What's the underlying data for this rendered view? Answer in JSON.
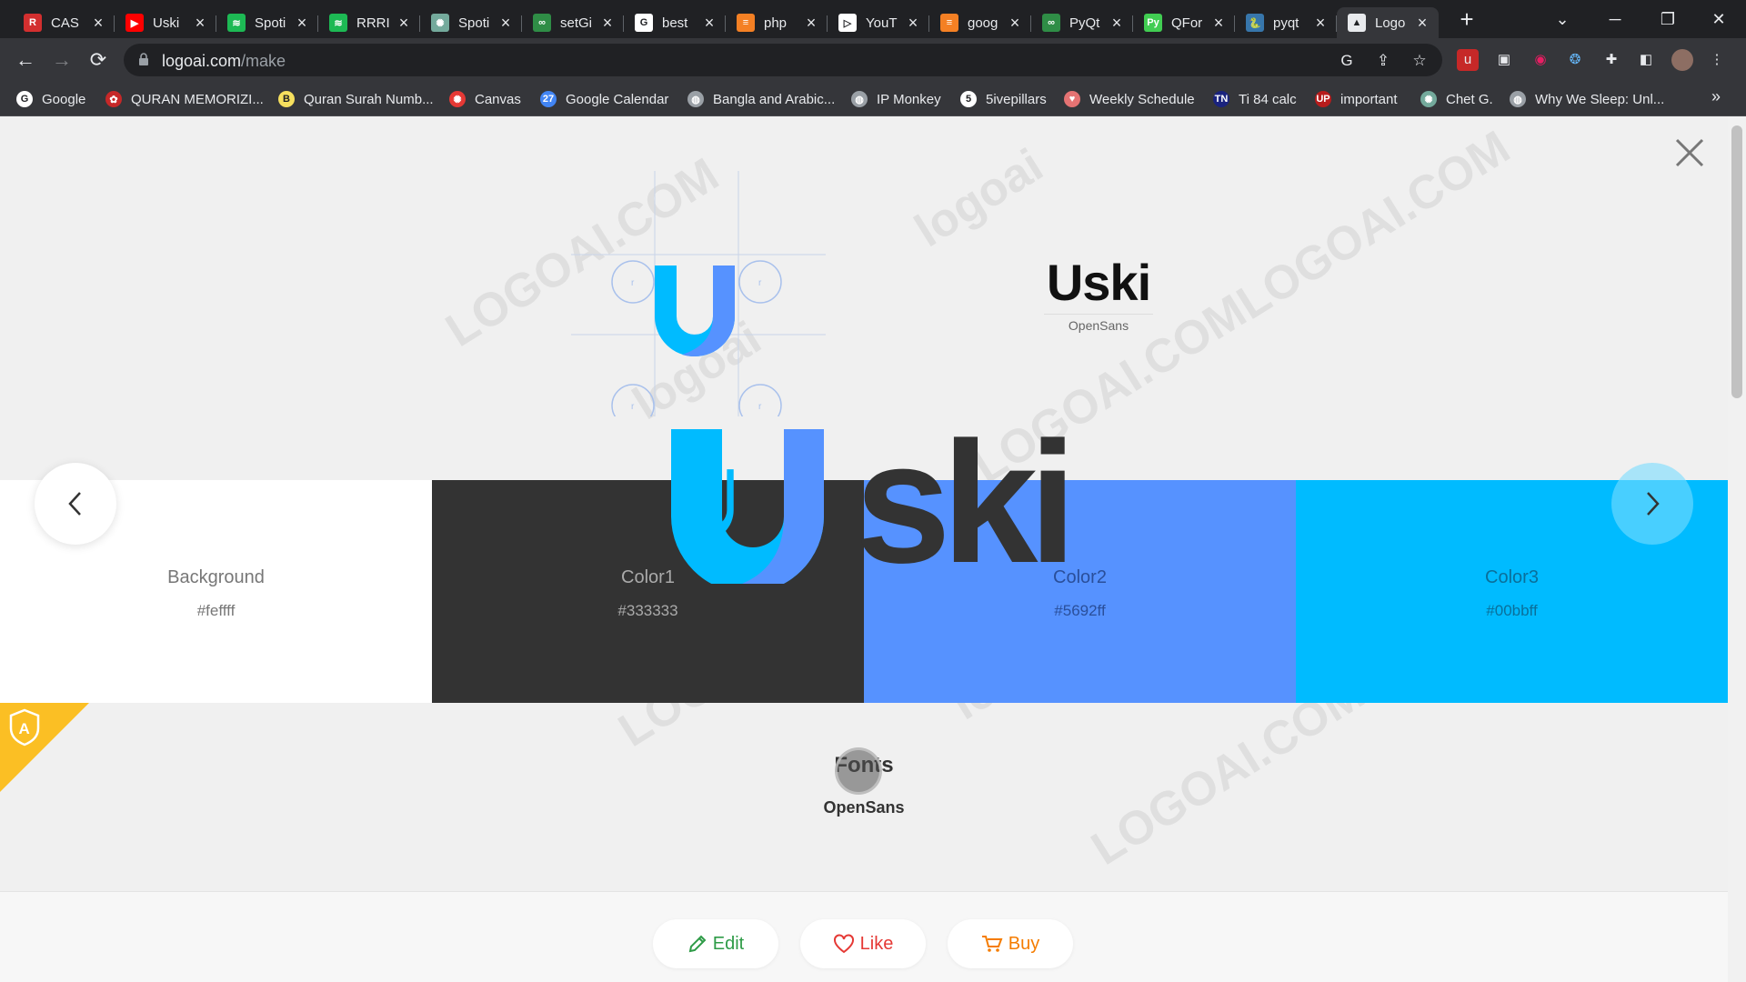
{
  "browser": {
    "tabs": [
      {
        "title": "CAS",
        "icon": "r-logo-icon",
        "color": "#d32f2f",
        "glyph": "R"
      },
      {
        "title": "Uski",
        "icon": "youtube-icon",
        "color": "#ff0000",
        "glyph": "▶"
      },
      {
        "title": "Spoti",
        "icon": "spotify-icon",
        "color": "#1db954",
        "glyph": "≋"
      },
      {
        "title": "RRRI",
        "icon": "spotify-icon",
        "color": "#1db954",
        "glyph": "≋"
      },
      {
        "title": "Spoti",
        "icon": "chatgpt-icon",
        "color": "#74aa9c",
        "glyph": "✺"
      },
      {
        "title": "setGi",
        "icon": "gfg-icon",
        "color": "#2f8d46",
        "glyph": "∞"
      },
      {
        "title": "best",
        "icon": "google-icon",
        "color": "#ffffff",
        "glyph": "G"
      },
      {
        "title": "php",
        "icon": "stackoverflow-icon",
        "color": "#f48024",
        "glyph": "≡"
      },
      {
        "title": "YouT",
        "icon": "youtube-studio-icon",
        "color": "#ffffff",
        "glyph": "▷"
      },
      {
        "title": "goog",
        "icon": "stackoverflow-icon",
        "color": "#f48024",
        "glyph": "≡"
      },
      {
        "title": "PyQt",
        "icon": "gfg-icon",
        "color": "#2f8d46",
        "glyph": "∞"
      },
      {
        "title": "QFor",
        "icon": "pyqt-icon",
        "color": "#41cd52",
        "glyph": "Py"
      },
      {
        "title": "pyqt",
        "icon": "python-icon",
        "color": "#3776ab",
        "glyph": "🐍"
      },
      {
        "title": "Logo",
        "icon": "logoai-icon",
        "color": "#e8eaed",
        "glyph": "▲",
        "active": true
      }
    ],
    "url_host": "logoai.com",
    "url_path": "/make",
    "bookmarks": [
      {
        "label": "Google",
        "icon": "google-icon",
        "color": "#ffffff",
        "glyph": "G"
      },
      {
        "label": "QURAN MEMORIZI...",
        "icon": "quran-icon",
        "color": "#c62828",
        "glyph": "✿"
      },
      {
        "label": "Quran Surah Numb...",
        "icon": "b-icon",
        "color": "#f6e05e",
        "glyph": "B"
      },
      {
        "label": "Canvas",
        "icon": "canvas-icon",
        "color": "#e53935",
        "glyph": "✺"
      },
      {
        "label": "Google Calendar",
        "icon": "calendar-icon",
        "color": "#4285f4",
        "glyph": "27"
      },
      {
        "label": "Bangla and Arabic...",
        "icon": "globe-icon",
        "color": "#9aa0a6",
        "glyph": "◍"
      },
      {
        "label": "IP Monkey",
        "icon": "globe-icon",
        "color": "#9aa0a6",
        "glyph": "◍"
      },
      {
        "label": "5ivepillars",
        "icon": "five-icon",
        "color": "#ffffff",
        "glyph": "5"
      },
      {
        "label": "Weekly Schedule",
        "icon": "schedule-icon",
        "color": "#e57373",
        "glyph": "♥"
      },
      {
        "label": "Ti 84 calc",
        "icon": "tn-icon",
        "color": "#1a237e",
        "glyph": "TN"
      },
      {
        "label": "important",
        "icon": "up-icon",
        "color": "#b71c1c",
        "glyph": "UP"
      },
      {
        "label": "Chet G.",
        "icon": "chatgpt-icon",
        "color": "#74aa9c",
        "glyph": "✺"
      },
      {
        "label": "Why We Sleep: Unl...",
        "icon": "globe-icon",
        "color": "#9aa0a6",
        "glyph": "◍"
      }
    ]
  },
  "logo": {
    "name": "Uski",
    "font_label": "OpenSans",
    "big_text": "ski"
  },
  "palette": [
    {
      "label": "Background",
      "hex": "#feffff",
      "bg": "#ffffff",
      "fg": "#777777"
    },
    {
      "label": "Color1",
      "hex": "#333333",
      "bg": "#333333",
      "fg": "#aaaaaa"
    },
    {
      "label": "Color2",
      "hex": "#5692ff",
      "bg": "#5692ff",
      "fg": "#2a4f9a"
    },
    {
      "label": "Color3",
      "hex": "#00bbff",
      "bg": "#00bbff",
      "fg": "#0a6f9a"
    }
  ],
  "fonts": {
    "heading": "Fonts",
    "font_name": "OpenSans"
  },
  "actions": {
    "edit": "Edit",
    "like": "Like",
    "buy": "Buy"
  },
  "watermarks": [
    "LOGOAI.COM",
    "logoai",
    "LOGOAI.COM",
    "logoai",
    "LOGOAI.COM",
    "logoai",
    "LOGOAI.COM",
    "logoai",
    "LOGOAI.COM"
  ]
}
